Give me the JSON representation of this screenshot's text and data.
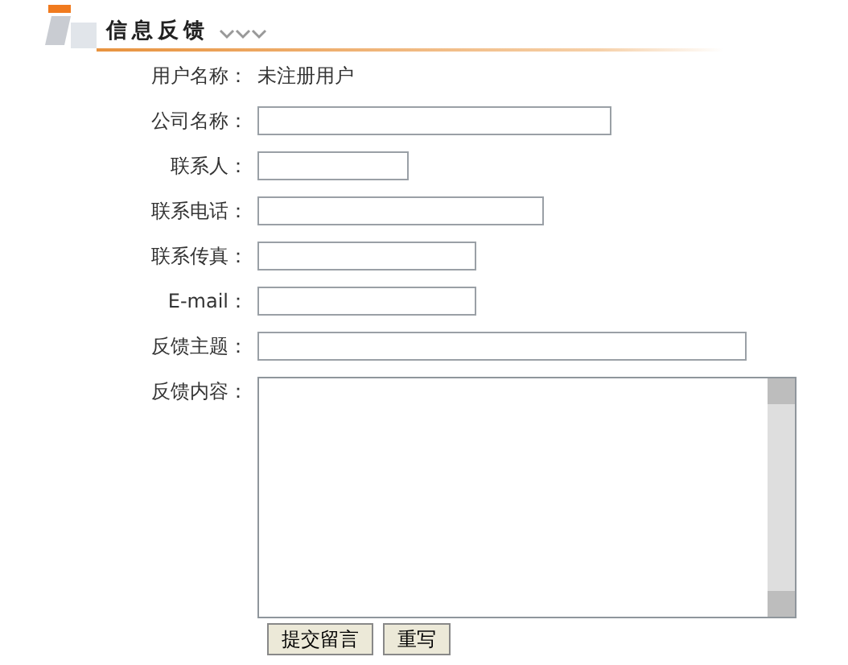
{
  "header": {
    "title": "信息反馈"
  },
  "user_name": {
    "label": "用户名称：",
    "value": "未注册用户"
  },
  "fields": [
    {
      "label": "公司名称：",
      "kind": "text"
    },
    {
      "label": "联系人：",
      "kind": "text"
    },
    {
      "label": "联系电话：",
      "kind": "text"
    },
    {
      "label": "联系传真：",
      "kind": "text"
    },
    {
      "label": "E-mail：",
      "kind": "text"
    },
    {
      "label": "反馈主题：",
      "kind": "text"
    },
    {
      "label": "反馈内容：",
      "kind": "textarea"
    }
  ],
  "buttons": [
    "提交留言",
    "重写"
  ]
}
